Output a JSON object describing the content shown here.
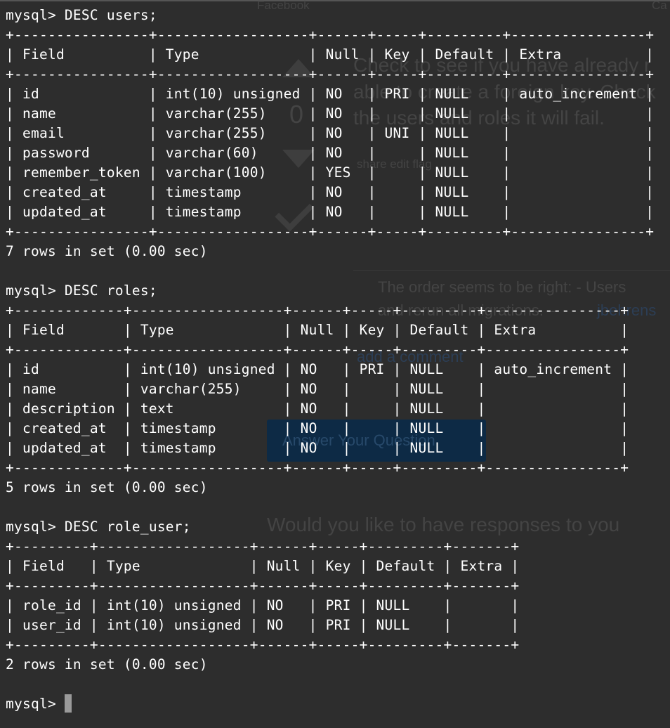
{
  "background_page": {
    "tab_left": "Facebook",
    "tab_right": "Ca",
    "vote_count": "0",
    "question_lines": [
      "Check to see if you have already r",
      "able to create a foreign key. Check",
      "the users and roles it will fail."
    ],
    "post_links": "share  edit  flag",
    "comment_line1": "The order seems to be right: - Users",
    "comment_line2": "and rerun all migrations. –",
    "comment_user": "jbehrens",
    "add_comment": "add a comment",
    "answer_button": "Answer Your Question",
    "notify_text": "Would you like to have responses to you"
  },
  "terminal": {
    "lines": [
      "mysql> DESC users;",
      "+----------------+------------------+------+-----+---------+----------------+",
      "| Field          | Type             | Null | Key | Default | Extra          |",
      "+----------------+------------------+------+-----+---------+----------------+",
      "| id             | int(10) unsigned | NO   | PRI | NULL    | auto_increment |",
      "| name           | varchar(255)     | NO   |     | NULL    |                |",
      "| email          | varchar(255)     | NO   | UNI | NULL    |                |",
      "| password       | varchar(60)      | NO   |     | NULL    |                |",
      "| remember_token | varchar(100)     | YES  |     | NULL    |                |",
      "| created_at     | timestamp        | NO   |     | NULL    |                |",
      "| updated_at     | timestamp        | NO   |     | NULL    |                |",
      "+----------------+------------------+------+-----+---------+----------------+",
      "7 rows in set (0.00 sec)",
      "",
      "mysql> DESC roles;",
      "+-------------+------------------+------+-----+---------+----------------+",
      "| Field       | Type             | Null | Key | Default | Extra          |",
      "+-------------+------------------+------+-----+---------+----------------+",
      "| id          | int(10) unsigned | NO   | PRI | NULL    | auto_increment |",
      "| name        | varchar(255)     | NO   |     | NULL    |                |",
      "| description | text             | NO   |     | NULL    |                |",
      "| created_at  | timestamp        | NO   |     | NULL    |                |",
      "| updated_at  | timestamp        | NO   |     | NULL    |                |",
      "+-------------+------------------+------+-----+---------+----------------+",
      "5 rows in set (0.00 sec)",
      "",
      "mysql> DESC role_user;",
      "+---------+------------------+------+-----+---------+-------+",
      "| Field   | Type             | Null | Key | Default | Extra |",
      "+---------+------------------+------+-----+---------+-------+",
      "| role_id | int(10) unsigned | NO   | PRI | NULL    |       |",
      "| user_id | int(10) unsigned | NO   | PRI | NULL    |       |",
      "+---------+------------------+------+-----+---------+-------+",
      "2 rows in set (0.00 sec)",
      "",
      "mysql> "
    ]
  }
}
